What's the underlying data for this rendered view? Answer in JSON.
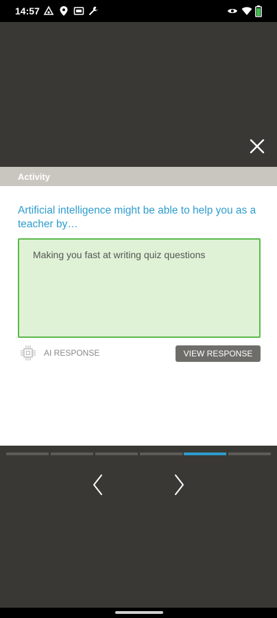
{
  "status_bar": {
    "time": "14:57",
    "left_icons": [
      "notification-icon",
      "location-icon",
      "cast-icon",
      "wrench-icon"
    ],
    "right_icons": [
      "eye-icon",
      "wifi-icon",
      "battery-icon"
    ]
  },
  "header": {
    "close_icon": "close-icon"
  },
  "activity": {
    "label": "Activity"
  },
  "main": {
    "question": "Artificial intelligence might be able to help you as a teacher by…",
    "response_text": "Making you fast at writing quiz questions",
    "ai_label": "AI RESPONSE",
    "view_response_label": "VIEW RESPONSE"
  },
  "progress": {
    "total_segments": 6,
    "active_index": 4
  },
  "navigation": {
    "prev_icon": "chevron-left-icon",
    "next_icon": "chevron-right-icon"
  },
  "colors": {
    "accent": "#2d9cce",
    "response_bg": "#dff2d6",
    "response_border": "#5bb84a",
    "dark_bg": "#3a3834"
  }
}
